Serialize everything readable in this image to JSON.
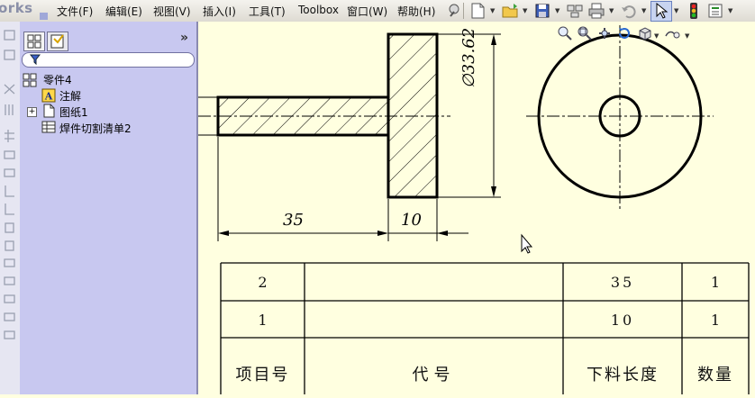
{
  "app": {
    "name": "orks"
  },
  "menu": [
    "文件(F)",
    "编辑(E)",
    "视图(V)",
    "插入(I)",
    "工具(T)",
    "Toolbox",
    "窗口(W)",
    "帮助(H)"
  ],
  "toolbar_icons": [
    "pin-icon",
    "new-document-icon",
    "open-folder-icon",
    "save-icon",
    "print-layout-icon",
    "print-icon",
    "undo-icon",
    "select-cursor-icon",
    "traffic-light-icon",
    "options-icon"
  ],
  "view_icons": [
    "zoom-fit-icon",
    "zoom-area-icon",
    "pan-icon",
    "rotate-icon",
    "cube-view-icon",
    "display-style-icon"
  ],
  "sidebar": {
    "tabs": [
      "feature-tree-tab",
      "property-tab"
    ],
    "expand_symbol": "»",
    "tree": [
      {
        "label": "零件4",
        "icon": "part-icon"
      },
      {
        "label": "注解",
        "icon": "annotation-icon"
      },
      {
        "label": "图纸1",
        "icon": "sheet-icon",
        "expander": "+"
      },
      {
        "label": "焊件切割清单2",
        "icon": "cut-list-icon"
      }
    ]
  },
  "drawing": {
    "dim_diameter": "∅33.62",
    "dim_length": "35",
    "dim_flange": "10"
  },
  "bom": {
    "rows": [
      {
        "item": "2",
        "code": "",
        "length": "35",
        "qty": "1"
      },
      {
        "item": "1",
        "code": "",
        "length": "10",
        "qty": "1"
      }
    ],
    "headers": {
      "item": "项目号",
      "code": "代号",
      "length": "下料长度",
      "qty": "数量"
    }
  }
}
